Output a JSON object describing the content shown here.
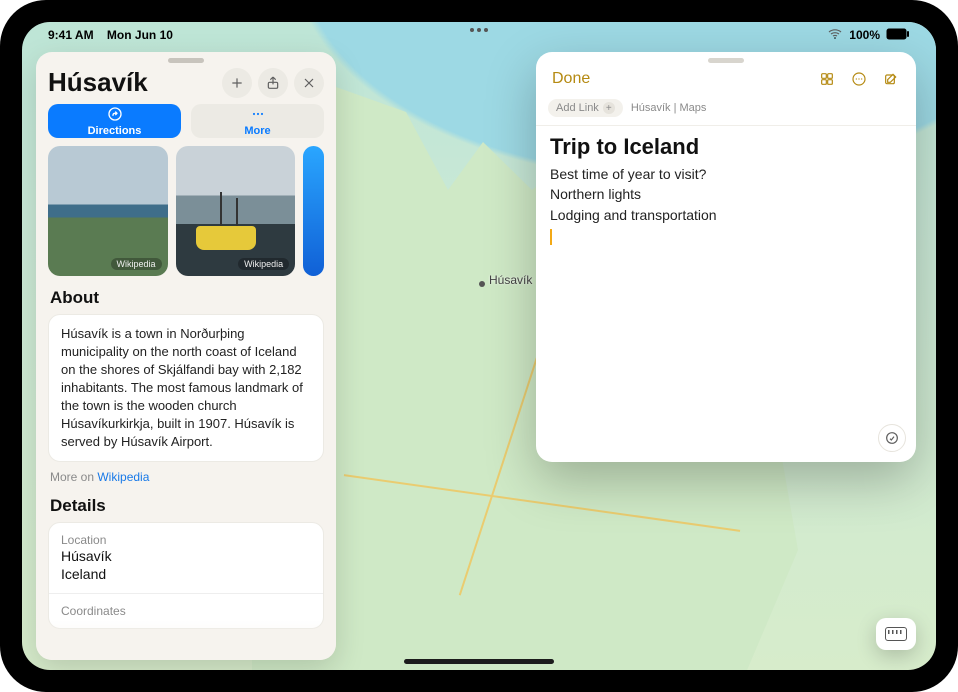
{
  "status": {
    "time": "9:41 AM",
    "date": "Mon Jun 10",
    "battery_pct": "100%"
  },
  "map": {
    "pin_label": "Húsavík"
  },
  "place_card": {
    "title": "Húsavík",
    "actions": {
      "directions": "Directions",
      "more": "More"
    },
    "photo_badges": [
      "Wikipedia",
      "Wikipedia"
    ],
    "about_heading": "About",
    "about_text": "Húsavík is a town in Norðurþing municipality on the north coast of Iceland on the shores of Skjálfandi bay with 2,182 inhabitants. The most famous landmark of the town is the wooden church Húsavíkurkirkja, built in 1907. Húsavík is served by Húsavík Airport.",
    "more_on_prefix": "More on ",
    "more_on_link": "Wikipedia",
    "details_heading": "Details",
    "details": {
      "location_label": "Location",
      "location_line1": "Húsavík",
      "location_line2": "Iceland",
      "coords_label": "Coordinates"
    }
  },
  "notes": {
    "done": "Done",
    "add_link": "Add Link",
    "breadcrumb": "Húsavík | Maps",
    "title": "Trip to Iceland",
    "lines": [
      "Best time of year to visit?",
      "Northern lights",
      "Lodging and transportation"
    ]
  }
}
